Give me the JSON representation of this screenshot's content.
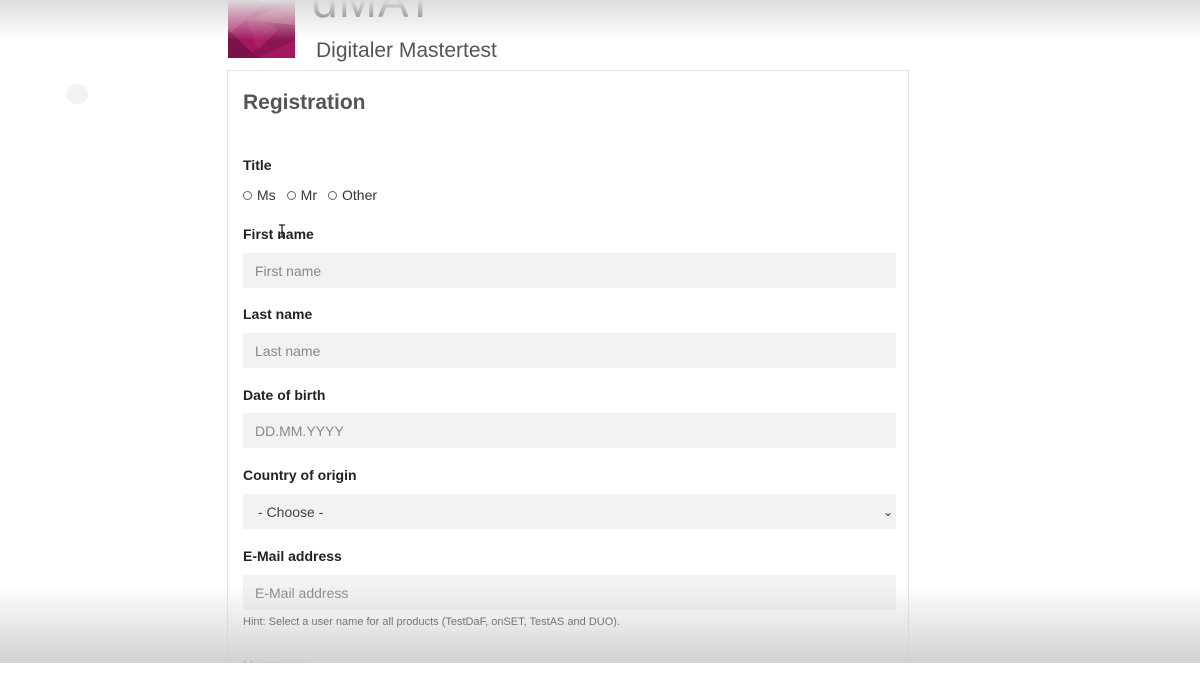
{
  "header": {
    "logo_title": "dMAT",
    "logo_subtitle": "Digitaler Mastertest",
    "brand_color": "#a3185f"
  },
  "form": {
    "title": "Registration",
    "title_field": {
      "label": "Title",
      "options": [
        "Ms",
        "Mr",
        "Other"
      ]
    },
    "first_name": {
      "label": "First name",
      "placeholder": "First name"
    },
    "last_name": {
      "label": "Last name",
      "placeholder": "Last name"
    },
    "date_of_birth": {
      "label": "Date of birth",
      "placeholder": "DD.MM.YYYY"
    },
    "country": {
      "label": "Country of origin",
      "selected": "- Choose -"
    },
    "email": {
      "label": "E-Mail address",
      "placeholder": "E-Mail address"
    },
    "hint": "Hint: Select a user name for all products (TestDaF, onSET, TestAS and DUO).",
    "username": {
      "label": "Username"
    }
  },
  "icons": {
    "cursor": "text-cursor-icon",
    "select_arrow": "chevron-down-icon"
  }
}
